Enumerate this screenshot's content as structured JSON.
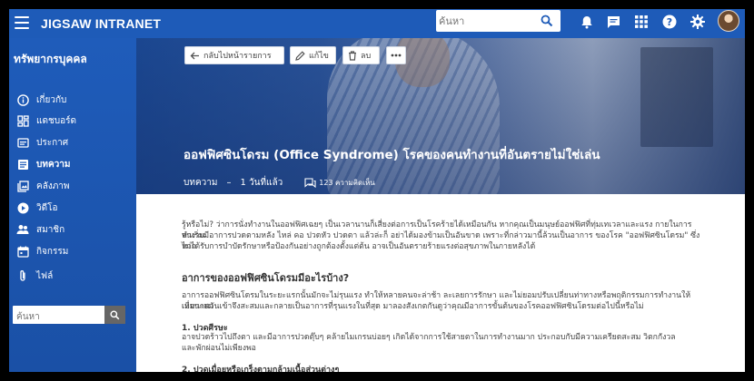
{
  "header": {
    "brand": "JIGSAW INTRANET",
    "search_placeholder": "ค้นหา",
    "icons": [
      "menu-icon",
      "search-icon",
      "bell-icon",
      "chat-icon",
      "apps-grid-icon",
      "help-icon",
      "settings-gear-icon",
      "user-avatar"
    ]
  },
  "sidebar": {
    "title": "ทรัพยากรบุคคล",
    "items": [
      {
        "label": "เกี่ยวกับ",
        "icon": "info-icon"
      },
      {
        "label": "แดชบอร์ด",
        "icon": "dashboard-icon"
      },
      {
        "label": "ประกาศ",
        "icon": "announcement-icon"
      },
      {
        "label": "บทความ",
        "icon": "article-icon",
        "active": true
      },
      {
        "label": "คลังภาพ",
        "icon": "gallery-icon"
      },
      {
        "label": "วิดีโอ",
        "icon": "video-icon"
      },
      {
        "label": "สมาชิก",
        "icon": "members-icon"
      },
      {
        "label": "กิจกรรม",
        "icon": "calendar-icon"
      },
      {
        "label": "ไฟล์",
        "icon": "attachment-icon"
      }
    ],
    "search_placeholder": "ค้นหา"
  },
  "hero": {
    "back_label": "กลับไปหน้ารายการ",
    "edit_label": "แก้ไข",
    "delete_label": "ลบ",
    "title": "ออฟฟิศซินโดรม (Office Syndrome) โรคของคนทำงานที่อันตรายไม่ใช่เล่น",
    "category": "บทความ",
    "separator": "–",
    "time": "1 วันที่แล้ว",
    "comments": "123 ความคิดเห็น"
  },
  "article": {
    "intro_1": "รู้หรือไม่? ว่าการนั่งทำงานในออฟฟิศเฉยๆ เป็นเวลานานก็เสี่ยงต่อการเป็นโรคร้ายได้เหมือนกัน หากคุณเป็นมนุษย์ออฟฟิศที่ทุ่มเทเวลาและแรง กายในการทำงาน",
    "intro_2": "จนเริ่มมีอาการปวดตามหลัง ไหล่ คอ ปวดหัว ปวดตา แล้วล่ะก็ อย่าได้มองข้ามเป็นอันขาด เพราะที่กล่าวมานี้ล้วนเป็นอาการ ของโรค \"ออฟฟิศซินโดรม\" ซึ่งหาก",
    "intro_3": "ไม่ได้รับการบำบัดรักษาหรือป้องกันอย่างถูกต้องตั้งแต่ต้น อาจเป็นอันตรายร้ายแรงต่อสุขภาพในภายหลังได้",
    "heading": "อาการของออฟฟิศซินโดรมมีอะไรบ้าง?",
    "para_1": "อาการออฟฟิศซินโดรมในระยะแรกนั้นมักจะไม่รุนแรง ทำให้หลายคนจะล่าช้า ละเลยการรักษา และไม่ยอมปรับเปลี่ยนท่าทางหรือพฤติกรรมการทำงานให้เหมาะสม",
    "para_2": "เมื่อนานวันเข้าจึงสะสมและกลายเป็นอาการที่รุนแรงในที่สุด มาลองสังเกตกันดูว่าคุณมีอาการขั้นต้นของโรคออฟฟิศซินโดรมต่อไปนี้หรือไม่",
    "sub_1": "1. ปวดศีรษะ",
    "sub_1_text_1": "อาจปวดร้าวไปถึงตา และมีอาการปวดตุ๊บๆ คล้ายไมเกรนบ่อยๆ เกิดได้จากการใช้สายตาในการทำงานมาก ประกอบกับมีความเครียดสะสม วิตกกังวล",
    "sub_1_text_2": "และพักผ่อนไม่เพียงพอ",
    "sub_2": "2. ปวดเมื่อยหรือเกร็งตามกล้ามเนื้อส่วนต่างๆ"
  }
}
